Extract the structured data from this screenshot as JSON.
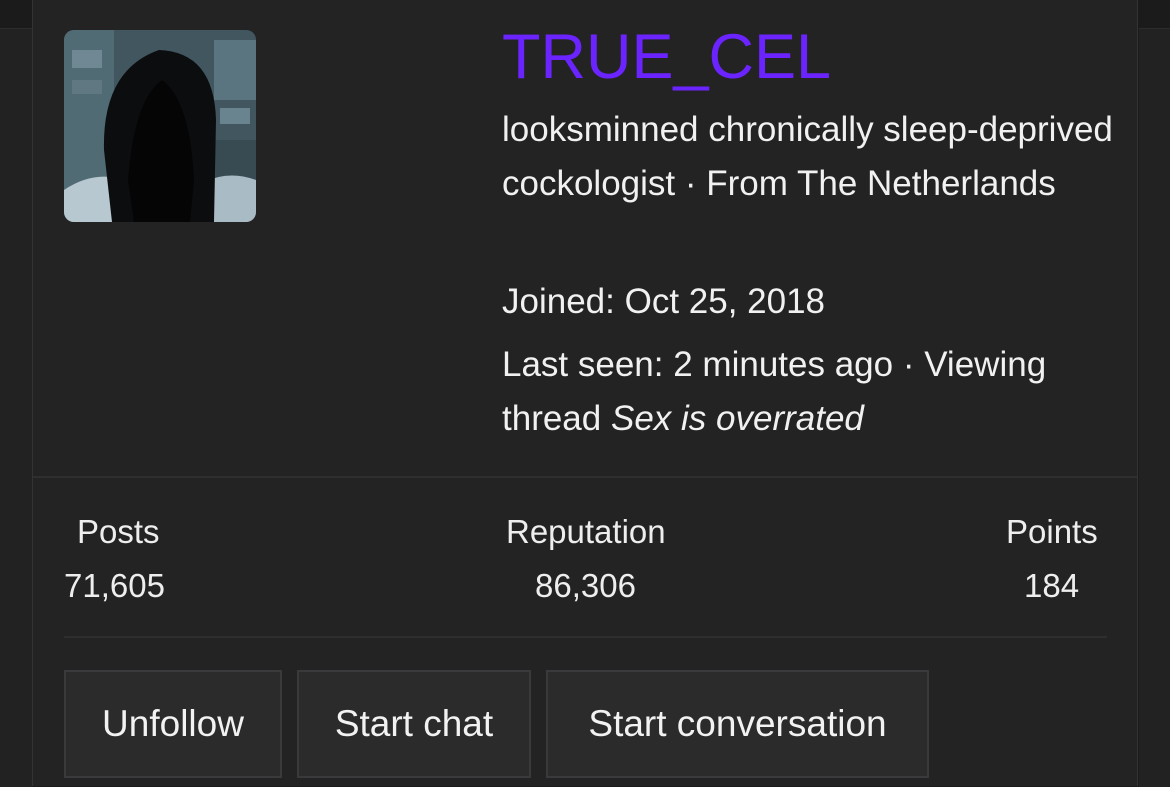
{
  "profile": {
    "username": "TRUE_CEL",
    "username_color": "#6b24ff",
    "tagline": "looksminned chronically sleep-deprived cockologist · From The Netherlands",
    "joined_label": "Joined:",
    "joined_date": "Oct 25, 2018",
    "last_seen_label": "Last seen:",
    "last_seen_time": "2 minutes ago",
    "activity_prefix": "· Viewing thread",
    "activity_thread": "Sex is overrated"
  },
  "stats": [
    {
      "label": "Posts",
      "value": "71,605"
    },
    {
      "label": "Reputation",
      "value": "86,306"
    },
    {
      "label": "Points",
      "value": "184"
    }
  ],
  "actions": {
    "unfollow": "Unfollow",
    "start_chat": "Start chat",
    "start_conversation": "Start conversation"
  }
}
